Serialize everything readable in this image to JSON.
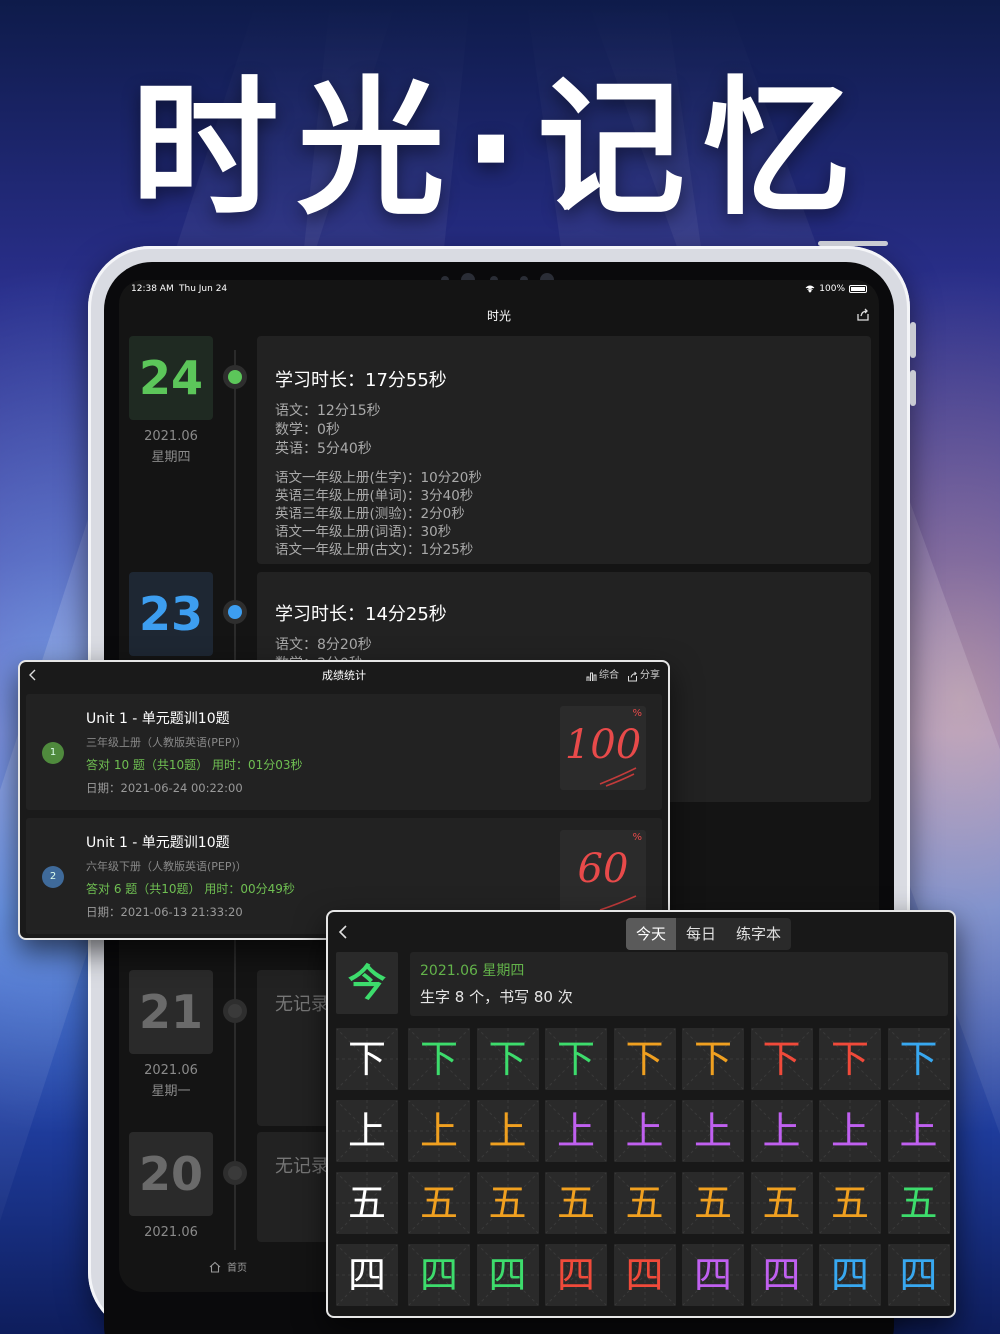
{
  "headline": "时光·记忆",
  "status_bar": {
    "time": "12:38 AM",
    "date": "Thu Jun 24",
    "battery": "100%"
  },
  "nav": {
    "title": "时光"
  },
  "timeline": [
    {
      "day": "24",
      "ym": "2021.06",
      "weekday": "星期四",
      "color": "#5cc65a",
      "card_bg": "#1f2a22",
      "duration": "学习时长：17分55秒",
      "subjects": [
        "语文：12分15秒",
        "数学：0秒",
        "英语：5分40秒"
      ],
      "items": [
        "语文一年级上册(生字)：10分20秒",
        "英语三年级上册(单词)：3分40秒",
        "英语三年级上册(测验)：2分0秒",
        "语文一年级上册(词语)：30秒",
        "语文一年级上册(古文)：1分25秒"
      ]
    },
    {
      "day": "23",
      "ym": "",
      "weekday": "",
      "color": "#3d9ef0",
      "card_bg": "#1e2733",
      "duration": "学习时长：14分25秒",
      "subjects": [
        "语文：8分20秒",
        "数学：3分0秒"
      ],
      "items": []
    },
    {
      "day": "21",
      "ym": "2021.06",
      "weekday": "星期一",
      "color": "#4a4a4a",
      "card_bg": "#2a2a2a",
      "empty": "无记录"
    },
    {
      "day": "20",
      "ym": "2021.06",
      "weekday": "",
      "color": "#4a4a4a",
      "card_bg": "#2a2a2a",
      "empty": "无记录"
    }
  ],
  "bottom_tab": {
    "home": "首页"
  },
  "scores_panel": {
    "title": "成绩统计",
    "tool_summary": "综合",
    "tool_share": "分享",
    "rows": [
      {
        "index": "1",
        "badge_color": "#4f8a3d",
        "title": "Unit 1 - 单元题训10题",
        "book": "三年级上册（人教版英语(PEP)）",
        "stat": "答对 10 题（共10题） 用时：01分03秒",
        "date": "日期：2021-06-24 00:22:00",
        "score": "100",
        "pct": "%"
      },
      {
        "index": "2",
        "badge_color": "#3f6a9a",
        "title": "Unit 1 - 单元题训10题",
        "book": "六年级下册（人教版英语(PEP)）",
        "stat": "答对 6 题（共10题） 用时：00分49秒",
        "date": "日期：2021-06-13 21:33:20",
        "score": "60",
        "pct": "%"
      }
    ]
  },
  "practice_panel": {
    "tabs": [
      "今天",
      "每日",
      "练字本"
    ],
    "active_tab": "今天",
    "today_char": "今",
    "today_date": "2021.06  星期四",
    "today_info": "生字 8 个，书写 80 次",
    "rows": [
      {
        "char": "下",
        "colors": [
          "#3ddc6c",
          "#3ddc6c",
          "#3ddc6c",
          "#f0a020",
          "#f0a020",
          "#f04a3a",
          "#f04a3a",
          "#38a8f0"
        ]
      },
      {
        "char": "上",
        "colors": [
          "#f0a020",
          "#f0a020",
          "#c060f0",
          "#c060f0",
          "#c060f0",
          "#c060f0",
          "#c060f0",
          "#c060f0"
        ]
      },
      {
        "char": "五",
        "colors": [
          "#f0a020",
          "#f0a020",
          "#f0a020",
          "#f0a020",
          "#f0a020",
          "#f0a020",
          "#f0a020",
          "#3ddc6c"
        ]
      },
      {
        "char": "四",
        "colors": [
          "#3ddc6c",
          "#3ddc6c",
          "#f04a3a",
          "#f04a3a",
          "#c060f0",
          "#c060f0",
          "#38a8f0",
          "#38a8f0"
        ]
      }
    ]
  }
}
